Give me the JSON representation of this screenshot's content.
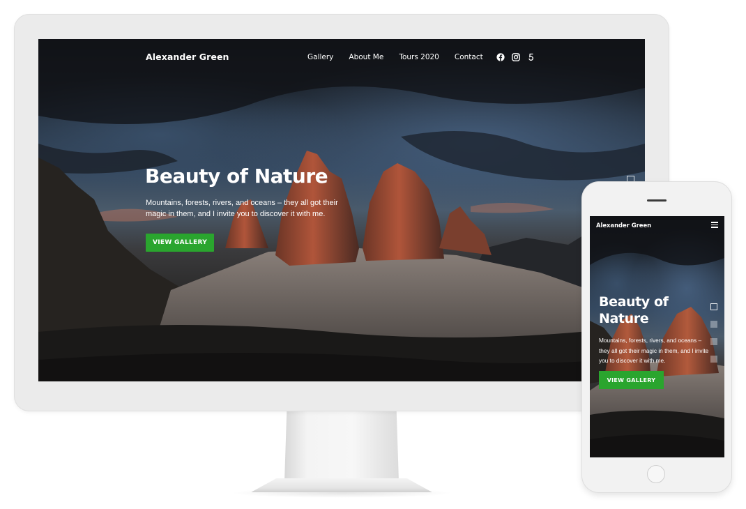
{
  "desktop": {
    "brand": "Alexander Green",
    "nav": [
      {
        "label": "Gallery"
      },
      {
        "label": "About Me"
      },
      {
        "label": "Tours 2020"
      },
      {
        "label": "Contact"
      }
    ],
    "social_icons": [
      "facebook-icon",
      "instagram-icon",
      "500px-icon"
    ],
    "hero": {
      "title": "Beauty of Nature",
      "text": "Mountains, forests, rivers, and oceans – they all got their magic in them, and I invite you to discover it with me.",
      "cta_label": "VIEW GALLERY"
    }
  },
  "mobile": {
    "brand": "Alexander Green",
    "menu_icon": "hamburger-menu-icon",
    "hero": {
      "title": "Beauty of Nature",
      "text": "Mountains, forests, rivers, and oceans – they all got their magic in them, and I invite you to discover it with me.",
      "cta_label": "VIEW GALLERY"
    },
    "slides": {
      "count": 4,
      "active": 1
    }
  },
  "colors": {
    "accent_green": "#2aa52e",
    "text_white": "#ffffff",
    "device_frame": "#ebebeb"
  }
}
